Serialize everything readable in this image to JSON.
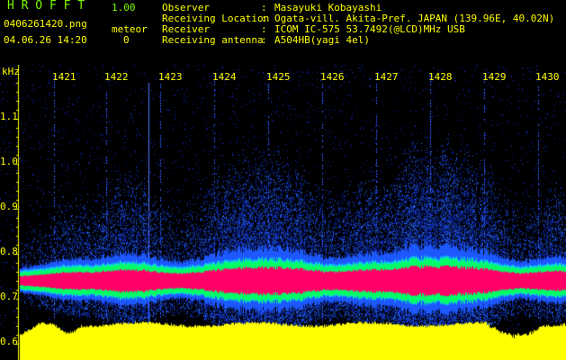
{
  "header": {
    "app_name": "H R O F F T",
    "version": "1.00",
    "filename": "0406261420.png",
    "datetime": "04.06.26 14:20",
    "meteor_label": "meteor",
    "meteor_count": "0"
  },
  "info": [
    {
      "key": "Observer",
      "value": "Masayuki Kobayashi"
    },
    {
      "key": "Receiving Location",
      "value": "Ogata-vill. Akita-Pref. JAPAN (139.96E, 40.02N)"
    },
    {
      "key": "Receiver",
      "value": "ICOM IC-575 53.7492(@LCD)MHz USB"
    },
    {
      "key": "Receiving antenna",
      "value": "A504HB(yagi 4el)"
    }
  ],
  "colon": ":",
  "axis": {
    "y_unit": "kHz",
    "y_ticks": [
      "1.1",
      "1.0",
      "0.9",
      "0.8",
      "0.7",
      "0.6"
    ],
    "x_ticks": [
      "1421",
      "1422",
      "1423",
      "1424",
      "1425",
      "1426",
      "1427",
      "1428",
      "1429",
      "1430"
    ]
  },
  "colors": {
    "text": "#ffff00",
    "title": "#7cfc00",
    "background": "#000000",
    "band_core": "#ff0066",
    "band_mid": "#00ff66",
    "band_outer": "#0044ff",
    "noise": "#1a3aff",
    "signal_strength": "#ffff00"
  },
  "chart_data": {
    "type": "heatmap",
    "y_unit": "kHz",
    "ylim": [
      0.6,
      1.2
    ],
    "x_ticks": [
      1421,
      1422,
      1423,
      1424,
      1425,
      1426,
      1427,
      1428,
      1429,
      1430
    ],
    "band_center_khz": 0.735,
    "meteor_count": 0
  }
}
